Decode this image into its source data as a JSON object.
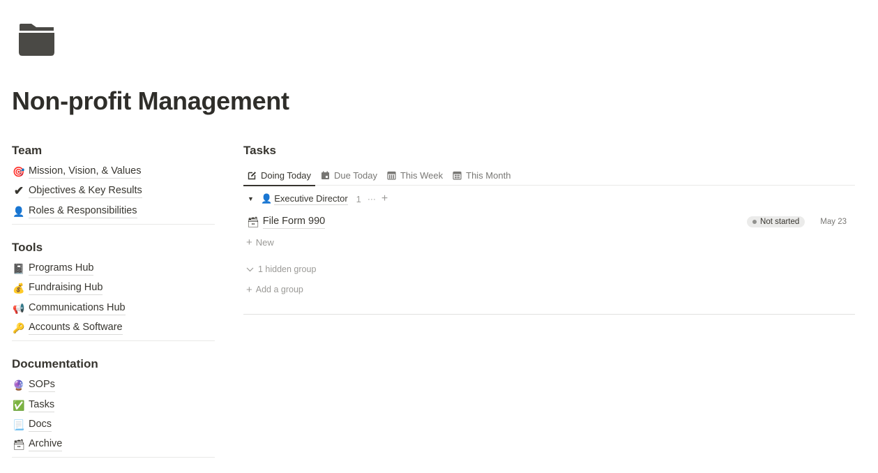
{
  "page": {
    "icon": "folder-icon",
    "title": "Non-profit Management"
  },
  "sections": [
    {
      "heading": "Team",
      "links": [
        {
          "emoji": "🎯",
          "icon": "dart-target-icon",
          "label": "Mission, Vision, & Values"
        },
        {
          "emoji": "✔",
          "icon": "checkmark-icon",
          "label": "Objectives & Key Results"
        },
        {
          "emoji": "👤",
          "icon": "person-icon",
          "label": "Roles & Responsibilities"
        }
      ]
    },
    {
      "heading": "Tools",
      "links": [
        {
          "emoji": "📓",
          "icon": "notebook-icon",
          "label": "Programs Hub"
        },
        {
          "emoji": "💰",
          "icon": "money-bag-icon",
          "label": "Fundraising Hub"
        },
        {
          "emoji": "📢",
          "icon": "megaphone-icon",
          "label": "Communications Hub"
        },
        {
          "emoji": "🔑",
          "icon": "key-icon",
          "label": "Accounts & Software"
        }
      ]
    },
    {
      "heading": "Documentation",
      "links": [
        {
          "emoji": "🔮",
          "icon": "crystal-ball-icon",
          "label": "SOPs"
        },
        {
          "emoji": "✅",
          "icon": "check-box-icon",
          "label": "Tasks"
        },
        {
          "emoji": "📃",
          "icon": "page-icon",
          "label": "Docs"
        },
        {
          "emoji": "🗃",
          "icon": "file-box-icon",
          "label": "Archive"
        }
      ]
    }
  ],
  "tasks": {
    "title": "Tasks",
    "tabs": [
      {
        "label": "Doing Today",
        "icon": "edit-icon",
        "active": true
      },
      {
        "label": "Due Today",
        "icon": "calendar-icon",
        "active": false
      },
      {
        "label": "This Week",
        "icon": "calendar-week-icon",
        "active": false
      },
      {
        "label": "This Month",
        "icon": "calendar-month-icon",
        "active": false
      }
    ],
    "group": {
      "toggle": "▼",
      "emoji": "👤",
      "label": "Executive Director",
      "count": "1",
      "more": "···",
      "add": "+"
    },
    "items": [
      {
        "emoji": "🗃",
        "name": "File Form 990",
        "status": "Not started",
        "due": "May 23"
      }
    ],
    "new_label": "New",
    "hidden_groups": "1 hidden group",
    "add_group": "Add a group"
  },
  "colors": {
    "text": "#37352f",
    "muted": "#9b9a97",
    "status_bg": "#ebebea",
    "divider": "#e9e9e7"
  }
}
